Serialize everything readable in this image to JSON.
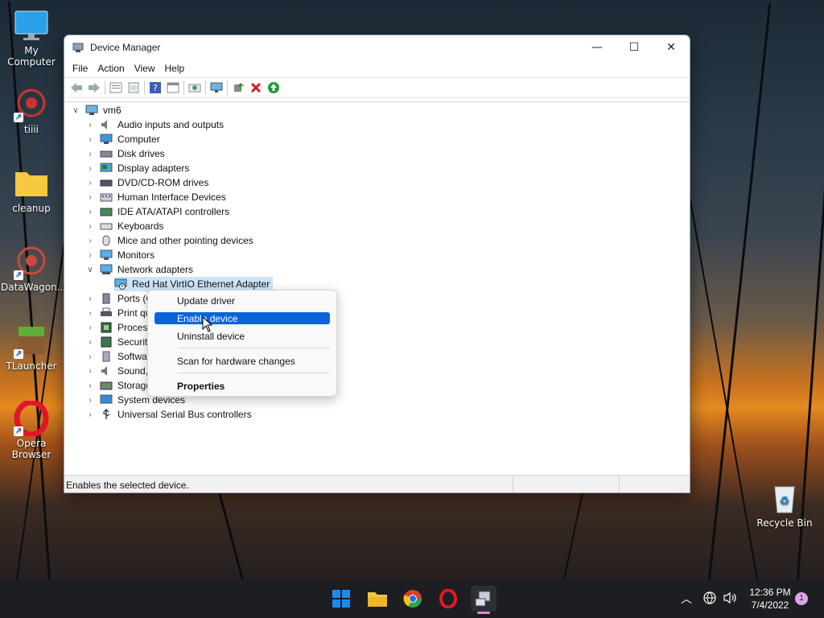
{
  "desktop": {
    "icons": [
      {
        "label": "My Computer",
        "icon": "monitor-icon"
      },
      {
        "label": "tiiii",
        "icon": "app-icon"
      },
      {
        "label": "cleanup",
        "icon": "folder-icon"
      },
      {
        "label": "DataWagon...",
        "icon": "app-icon"
      },
      {
        "label": "TLauncher",
        "icon": "minecraft-icon"
      },
      {
        "label": "Opera Browser",
        "icon": "opera-icon"
      },
      {
        "label": "Recycle Bin",
        "icon": "recycle-bin-icon"
      }
    ]
  },
  "window": {
    "title": "Device Manager",
    "controls": {
      "minimize": "—",
      "maximize": "☐",
      "close": "✕"
    },
    "menu": [
      "File",
      "Action",
      "View",
      "Help"
    ],
    "toolbar_icons": [
      "back-icon",
      "forward-icon",
      "properties-icon",
      "show-hide-icon",
      "help-icon",
      "update-driver-icon",
      "scan-icon",
      "monitor-icon",
      "add-legacy-icon",
      "uninstall-icon",
      "enable-icon"
    ],
    "tree": {
      "root": "vm6",
      "categories": [
        "Audio inputs and outputs",
        "Computer",
        "Disk drives",
        "Display adapters",
        "DVD/CD-ROM drives",
        "Human Interface Devices",
        "IDE ATA/ATAPI controllers",
        "Keyboards",
        "Mice and other pointing devices",
        "Monitors",
        "Network adapters",
        "Ports (C",
        "Print qu",
        "Process",
        "Security",
        "Softwar",
        "Sound,",
        "Storage",
        "System devices",
        "Universal Serial Bus controllers"
      ],
      "expanded_child": "Red Hat VirtIO Ethernet Adapter"
    },
    "status": "Enables the selected device."
  },
  "context_menu": {
    "items": [
      "Update driver",
      "Enable device",
      "Uninstall device",
      "Scan for hardware changes",
      "Properties"
    ],
    "highlighted": "Enable device"
  },
  "taskbar": {
    "pinned": [
      "start-icon",
      "file-explorer-icon",
      "chrome-icon",
      "opera-icon",
      "device-manager-icon"
    ],
    "time": "12:36 PM",
    "date": "7/4/2022",
    "notification_count": "1"
  },
  "colors": {
    "accent": "#0a64d8",
    "selection": "#cce4f7"
  }
}
